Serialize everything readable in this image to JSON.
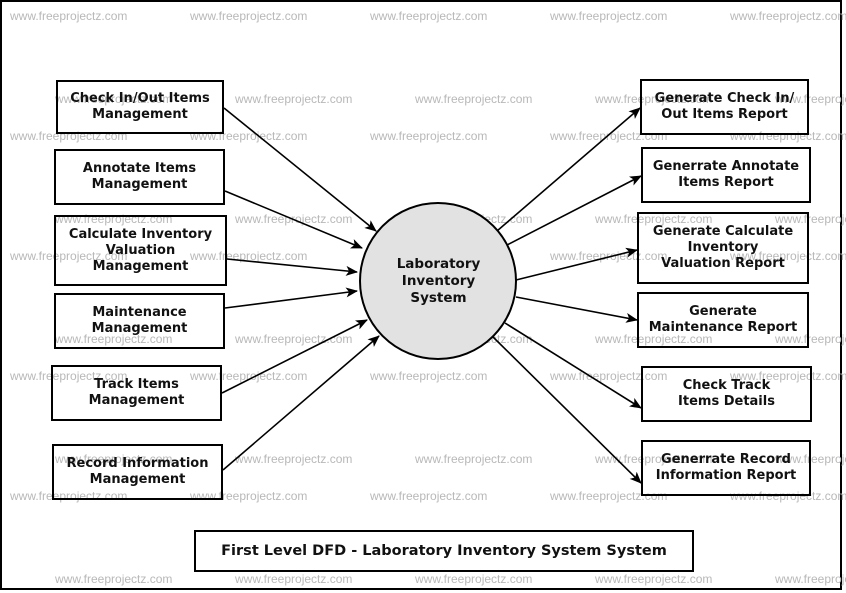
{
  "diagram": {
    "title": "First Level DFD - Laboratory Inventory System System",
    "watermark": "www.freeprojectz.com",
    "process": {
      "label_lines": [
        "Laboratory",
        "Inventory",
        "System"
      ],
      "fill_color": "#e2e2e2"
    },
    "inputs": [
      {
        "label_lines": [
          "Check In/Out Items",
          "Management"
        ]
      },
      {
        "label_lines": [
          "Annotate Items",
          "Management"
        ]
      },
      {
        "label_lines": [
          "Calculate Inventory",
          "Valuation",
          "Management"
        ]
      },
      {
        "label_lines": [
          "Maintenance",
          "Management"
        ]
      },
      {
        "label_lines": [
          "Track Items",
          "Management"
        ]
      },
      {
        "label_lines": [
          "Record Information",
          "Management"
        ]
      }
    ],
    "outputs": [
      {
        "label_lines": [
          "Generate Check In/",
          "Out Items Report"
        ]
      },
      {
        "label_lines": [
          "Generrate Annotate",
          "Items Report"
        ]
      },
      {
        "label_lines": [
          "Generate Calculate",
          "Inventory",
          "Valuation Report"
        ]
      },
      {
        "label_lines": [
          "Generate",
          "Maintenance Report"
        ]
      },
      {
        "label_lines": [
          "Check Track",
          "Items Details"
        ]
      },
      {
        "label_lines": [
          "Generrate Record",
          "Information Report"
        ]
      }
    ],
    "flows": [
      {
        "from": "inputs.0",
        "to": "process"
      },
      {
        "from": "inputs.1",
        "to": "process"
      },
      {
        "from": "inputs.2",
        "to": "process"
      },
      {
        "from": "inputs.3",
        "to": "process"
      },
      {
        "from": "inputs.4",
        "to": "process"
      },
      {
        "from": "inputs.5",
        "to": "process"
      },
      {
        "from": "process",
        "to": "outputs.0"
      },
      {
        "from": "process",
        "to": "outputs.1"
      },
      {
        "from": "process",
        "to": "outputs.2"
      },
      {
        "from": "process",
        "to": "outputs.3"
      },
      {
        "from": "process",
        "to": "outputs.4"
      },
      {
        "from": "process",
        "to": "outputs.5"
      }
    ]
  }
}
